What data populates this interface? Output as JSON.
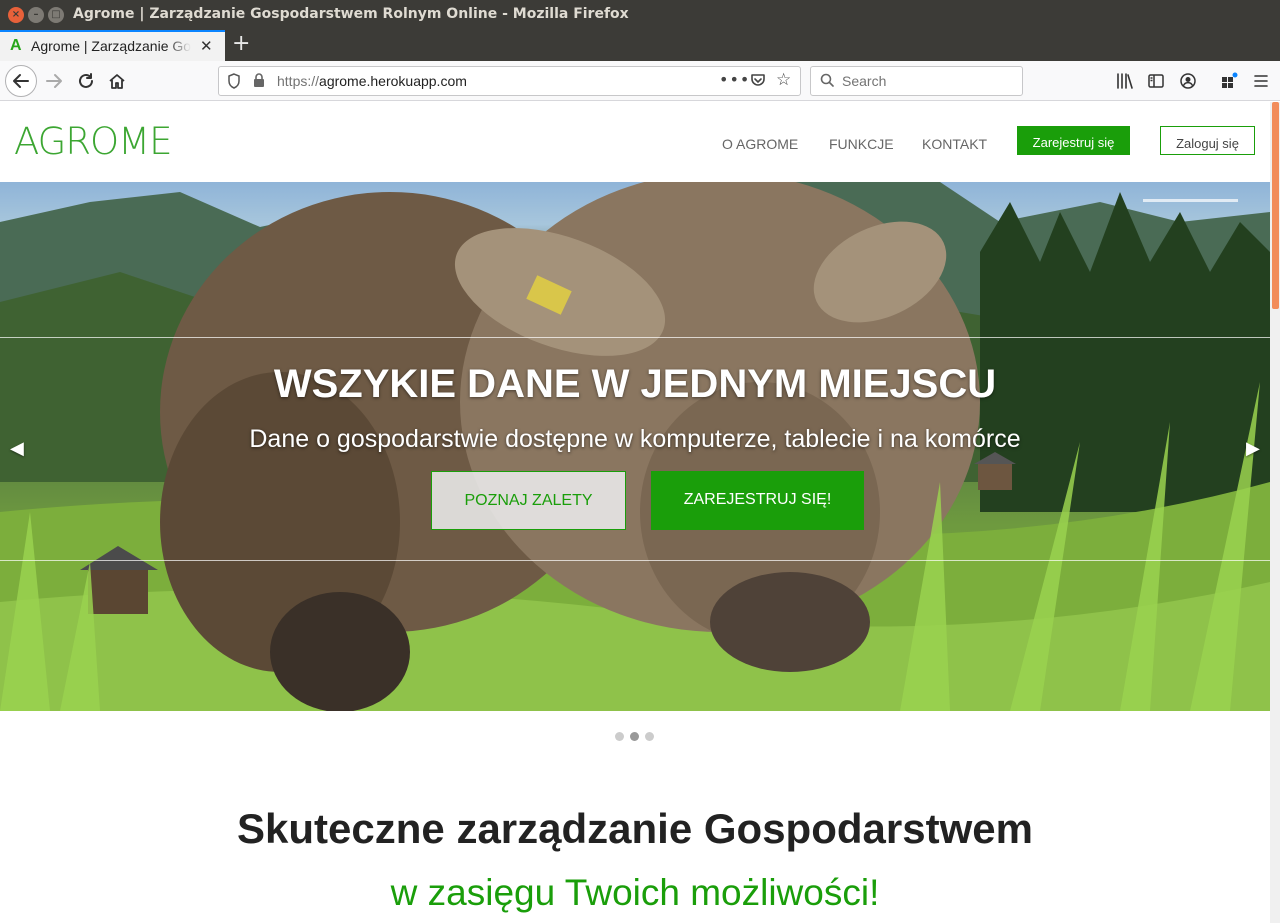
{
  "window": {
    "title": "Agrome | Zarządzanie Gospodarstwem Rolnym Online - Mozilla Firefox"
  },
  "tabs": [
    {
      "label": "Agrome | Zarządzanie Gospodarstwem Rolnym Online",
      "favicon": "A"
    }
  ],
  "toolbar": {
    "url_scheme": "https://",
    "url_host": "agrome.herokuapp.com",
    "more_label": "•••",
    "search_placeholder": "Search"
  },
  "site": {
    "logo": "AGROME",
    "nav": [
      "O AGROME",
      "FUNKCJE",
      "KONTAKT"
    ],
    "register_label": "Zarejestruj się",
    "login_label": "Zaloguj się"
  },
  "hero": {
    "title": "WSZYKIE DANE W JEDNYM MIEJSCU",
    "subtitle": "Dane o gospodarstwie dostępne w komputerze, tablecie i na komórce",
    "learn_button": "POZNAJ ZALETY",
    "register_button": "ZAREJESTRUJ SIĘ!",
    "slide_count": 3,
    "active_slide": 2
  },
  "intro": {
    "title_plain": "Skuteczne zarządzanie ",
    "title_bold": "Gospodarstwem",
    "subtitle": "w zasięgu Twoich możliwości!"
  },
  "colors": {
    "brand_green": "#1a9e0a",
    "logo_green": "#3ca632",
    "scrollbar_accent": "#f28c5a"
  }
}
